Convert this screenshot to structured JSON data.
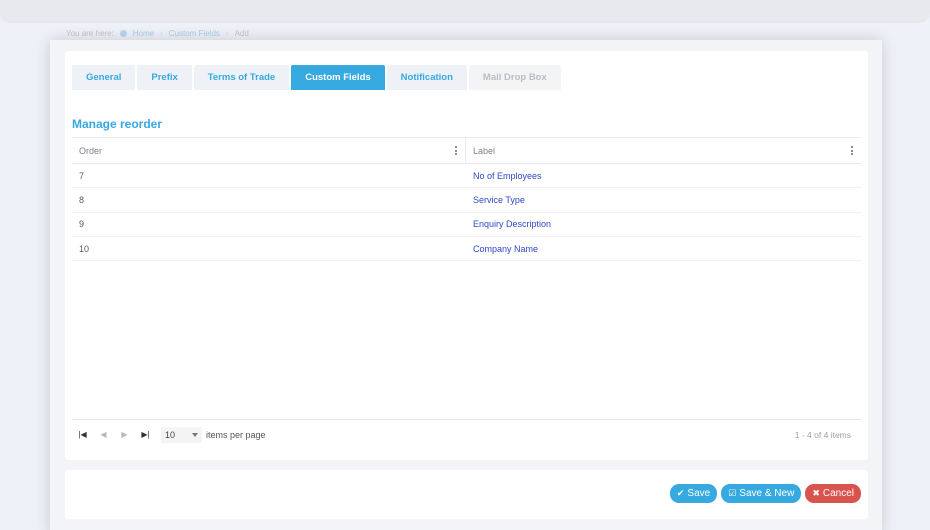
{
  "breadcrumb": {
    "prefix": "You are here:",
    "items": [
      "Home",
      "Custom Fields",
      "Add"
    ]
  },
  "tabs": [
    {
      "label": "General",
      "state": "normal"
    },
    {
      "label": "Prefix",
      "state": "normal"
    },
    {
      "label": "Terms of Trade",
      "state": "normal"
    },
    {
      "label": "Custom Fields",
      "state": "active"
    },
    {
      "label": "Notification",
      "state": "normal"
    },
    {
      "label": "Mail Drop Box",
      "state": "disabled"
    }
  ],
  "section_title": "Manage reorder",
  "grid": {
    "columns": [
      "Order",
      "Label"
    ],
    "rows": [
      {
        "order": "7",
        "label": "No of Employees"
      },
      {
        "order": "8",
        "label": "Service Type"
      },
      {
        "order": "9",
        "label": "Enquiry Description"
      },
      {
        "order": "10",
        "label": "Company Name"
      }
    ]
  },
  "pager": {
    "page_size": "10",
    "items_per_page_label": "items per page",
    "info": "1 - 4 of 4 items"
  },
  "actions": {
    "save": "Save",
    "save_new": "Save & New",
    "cancel": "Cancel"
  },
  "colors": {
    "accent": "#36a9e1",
    "danger": "#d9534f",
    "link": "#2f48c9"
  }
}
